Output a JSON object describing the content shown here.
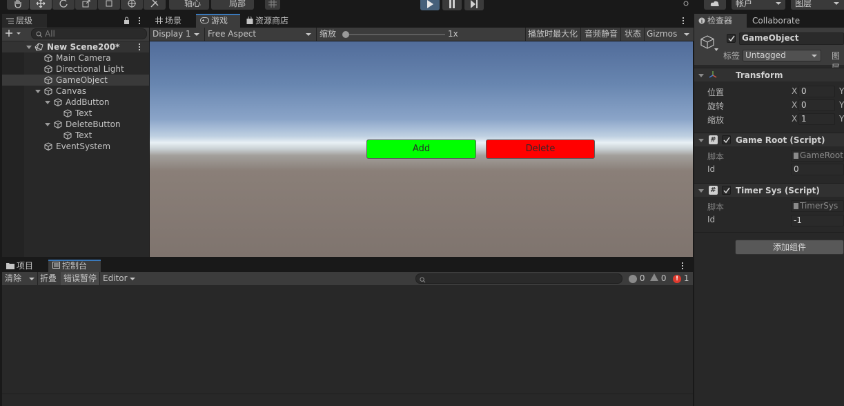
{
  "toolbar": {
    "pivot_label": "轴心",
    "local_label": "局部",
    "account_label": "帐户",
    "layers_label": "图层"
  },
  "hierarchy": {
    "tab_label": "层级",
    "search_placeholder": "All",
    "scene_name": "New Scene200*",
    "items": [
      {
        "label": "Main Camera"
      },
      {
        "label": "Directional Light"
      },
      {
        "label": "GameObject"
      },
      {
        "label": "Canvas"
      },
      {
        "label": "AddButton"
      },
      {
        "label": "Text"
      },
      {
        "label": "DeleteButton"
      },
      {
        "label": "Text"
      },
      {
        "label": "EventSystem"
      }
    ]
  },
  "center_tabs": {
    "scene": "场景",
    "game": "游戏",
    "asset_store": "资源商店"
  },
  "game_toolbar": {
    "display": "Display 1",
    "aspect": "Free Aspect",
    "scale_label": "缩放",
    "scale_value": "1x",
    "scale_level": 0,
    "maximize_on_play": "播放时最大化",
    "mute_audio": "音频静音",
    "stats": "状态",
    "gizmos": "Gizmos"
  },
  "game_view": {
    "add_button": "Add",
    "delete_button": "Delete",
    "add_color": "#00ff00",
    "delete_color": "#ff0000"
  },
  "inspector": {
    "tab_label": "检查器",
    "collab_tab": "Collaborate",
    "object_name": "GameObject",
    "tag_label": "标签",
    "tag_value": "Untagged",
    "layer_label": "图层",
    "transform": {
      "title": "Transform",
      "rows": [
        {
          "label": "位置",
          "axis": "X",
          "value": "0",
          "axis2": "Y"
        },
        {
          "label": "旋转",
          "axis": "X",
          "value": "0",
          "axis2": "Y"
        },
        {
          "label": "缩放",
          "axis": "X",
          "value": "1",
          "axis2": "Y"
        }
      ]
    },
    "components": [
      {
        "title": "Game Root (Script)",
        "script_label": "脚本",
        "script_value": "GameRoot",
        "field_label": "Id",
        "field_value": "0"
      },
      {
        "title": "Timer Sys (Script)",
        "script_label": "脚本",
        "script_value": "TimerSys",
        "field_label": "Id",
        "field_value": "-1"
      }
    ],
    "add_component": "添加组件"
  },
  "bottom_tabs": {
    "project": "项目",
    "console": "控制台"
  },
  "console": {
    "clear": "清除",
    "collapse": "折叠",
    "error_pause": "错误暂停",
    "editor": "Editor",
    "info_count": "0",
    "warning_count": "0",
    "error_count": "1"
  }
}
